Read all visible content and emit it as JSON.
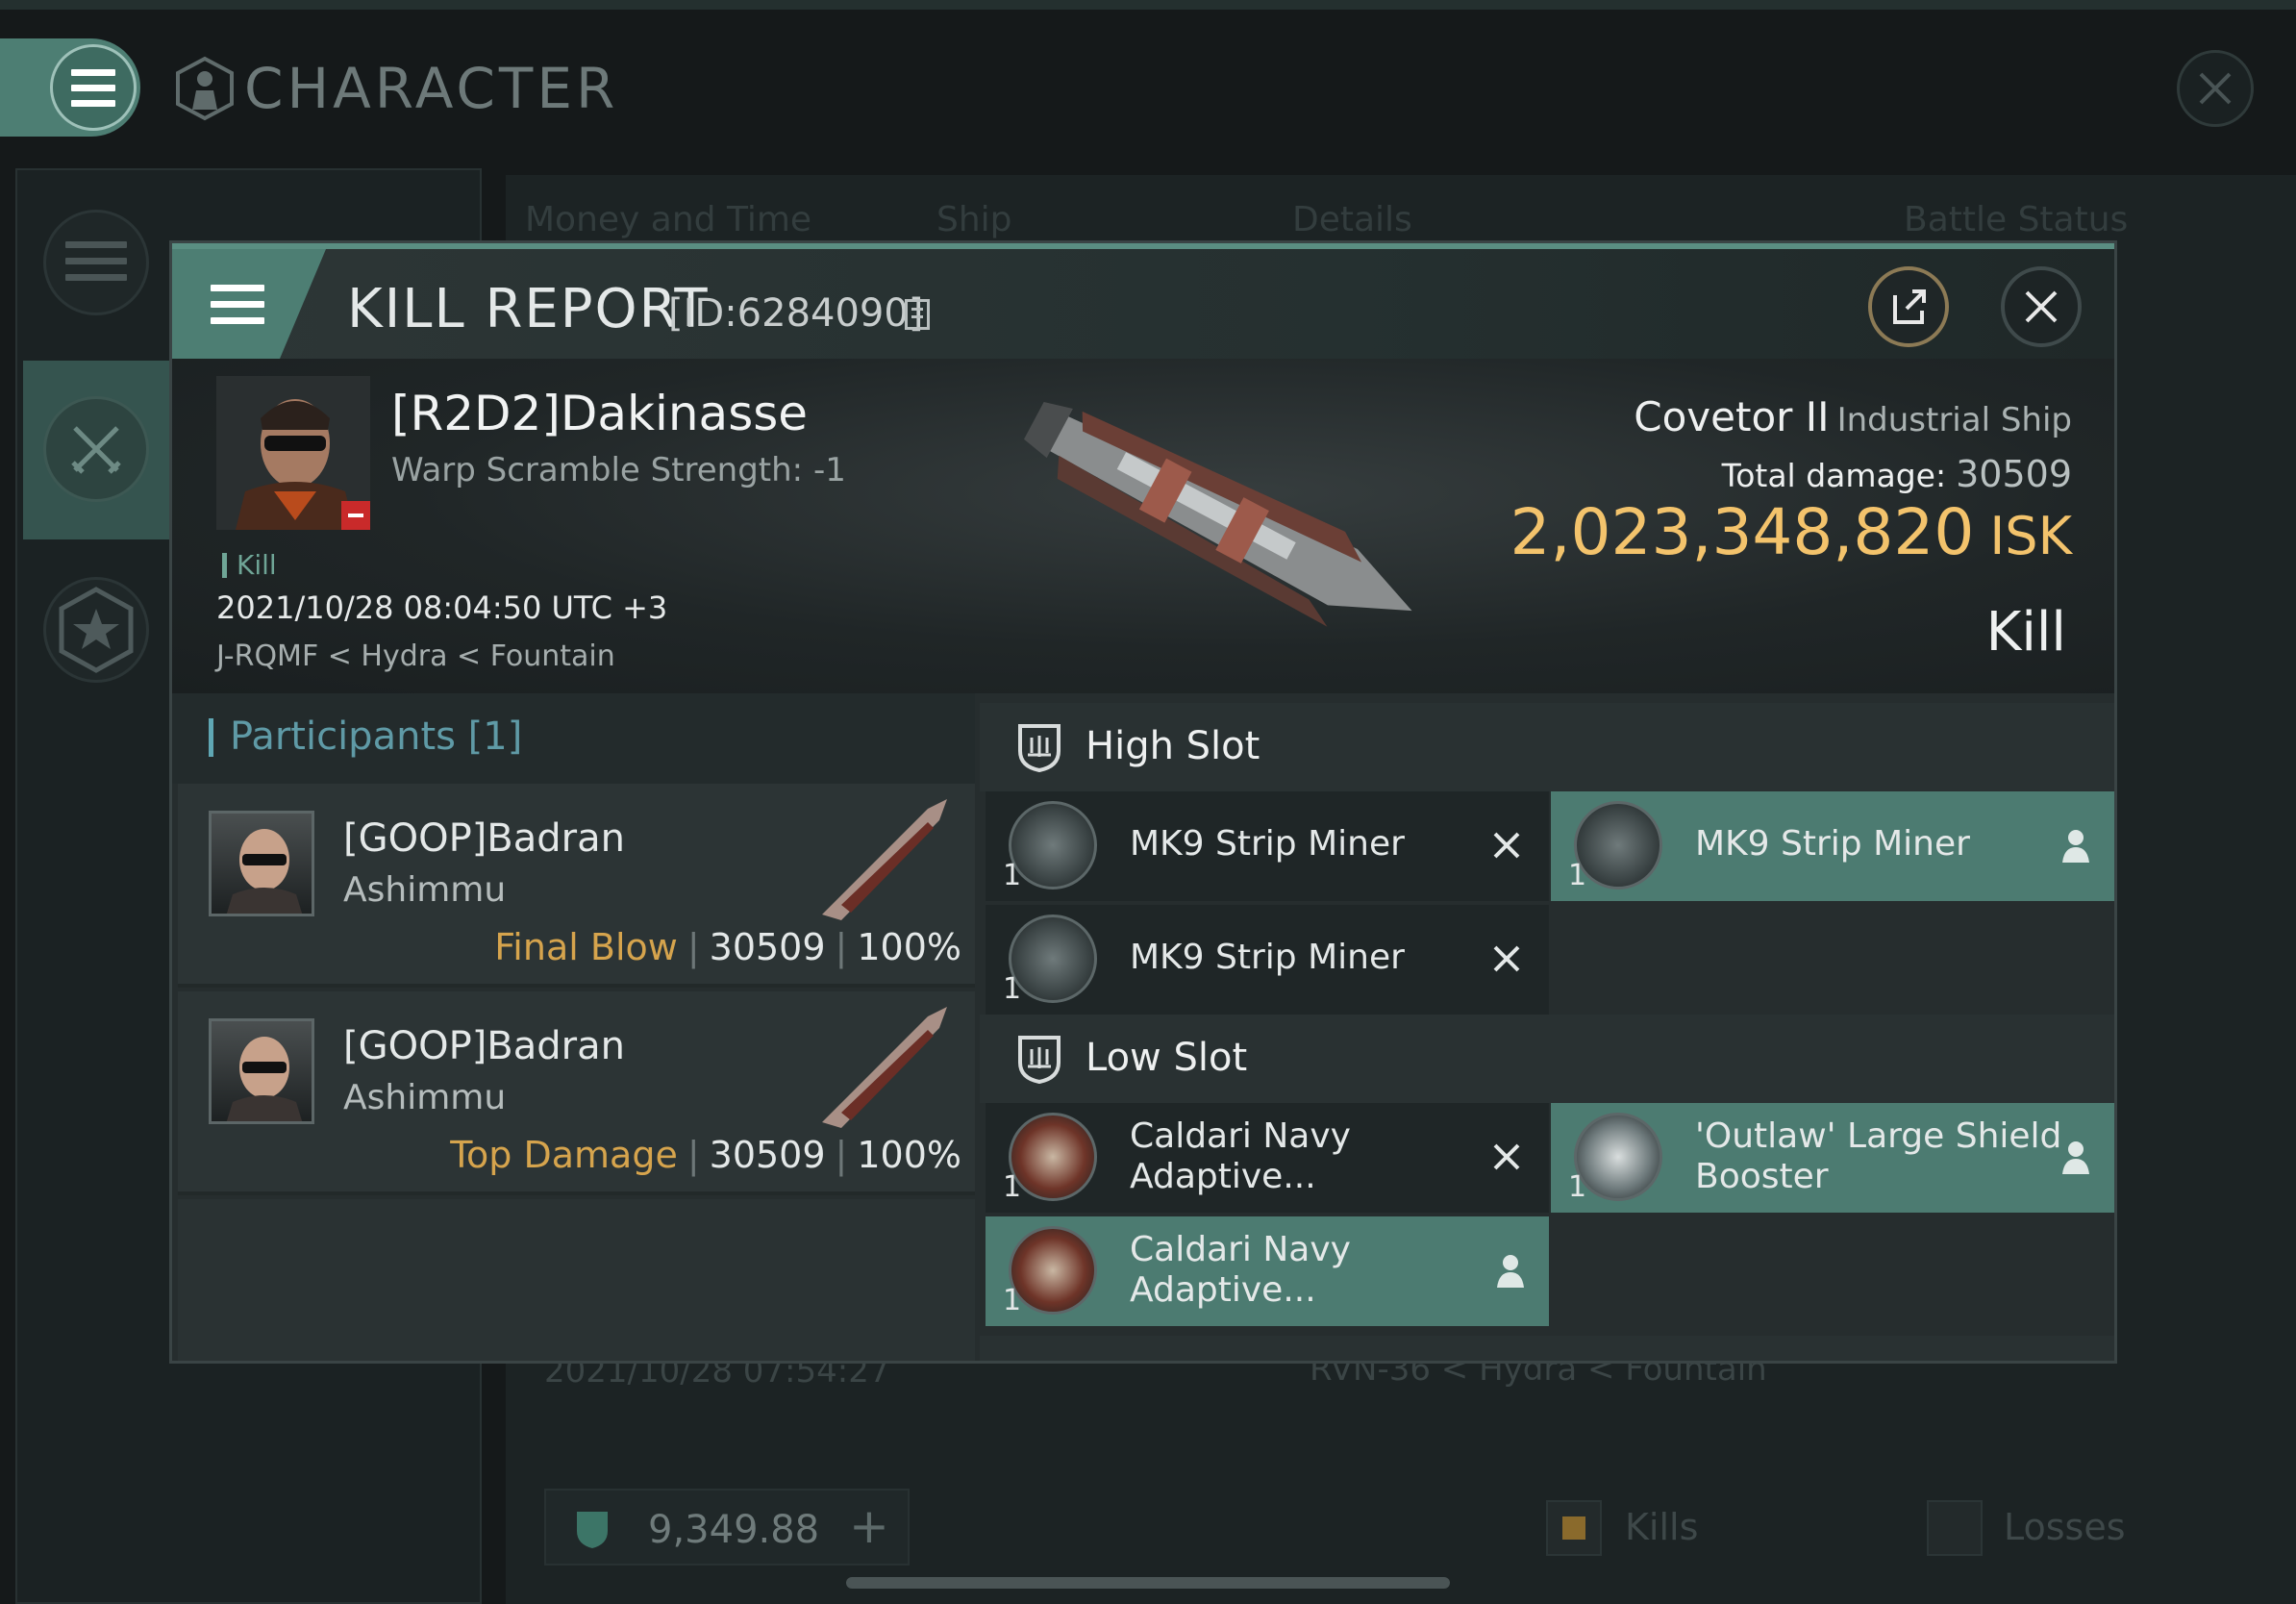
{
  "window": {
    "title": "CHARACTER"
  },
  "background": {
    "tabs": [
      "Money and Time",
      "Ship",
      "Details",
      "Battle Status"
    ],
    "row_date": "2021/10/28  07:54:27",
    "row_location": "RVN-36 < Hydra < Fountain",
    "wallet": "9,349.88",
    "legend_kills": "Kills",
    "legend_losses": "Losses"
  },
  "kill_report": {
    "title": "KILL REPORT",
    "id": "[ID:6284090]",
    "victim": {
      "name": "[R2D2]Dakinasse",
      "warp": "Warp Scramble Strength: -1",
      "tag": "Kill",
      "datetime": "2021/10/28 08:04:50 UTC +3",
      "location": "J-RQMF < Hydra < Fountain"
    },
    "ship": {
      "name": "Covetor II",
      "class": "Industrial Ship",
      "total_damage_label": "Total damage:",
      "total_damage": "30509",
      "isk_value": "2,023,348,820",
      "isk_unit": "ISK",
      "result": "Kill"
    },
    "participants": {
      "header": "Participants [1]",
      "items": [
        {
          "name": "[GOOP]Badran",
          "ship": "Ashimmu",
          "label": "Final Blow",
          "damage": "30509",
          "percent": "100%"
        },
        {
          "name": "[GOOP]Badran",
          "ship": "Ashimmu",
          "label": "Top Damage",
          "damage": "30509",
          "percent": "100%"
        }
      ]
    },
    "slots": {
      "high": {
        "label": "High Slot",
        "modules": [
          {
            "qty": "1",
            "name": "MK9 Strip Miner",
            "state": "destroyed",
            "icon": "strip-miner-icon"
          },
          {
            "qty": "1",
            "name": "MK9 Strip Miner",
            "state": "dropped",
            "icon": "strip-miner-icon"
          },
          {
            "qty": "1",
            "name": "MK9 Strip Miner",
            "state": "destroyed",
            "icon": "strip-miner-icon"
          }
        ]
      },
      "low": {
        "label": "Low Slot",
        "modules": [
          {
            "qty": "1",
            "name": "Caldari Navy Adaptive...",
            "line1": "Caldari Navy",
            "line2": "Adaptive...",
            "state": "destroyed",
            "icon": "adaptive-plating-icon"
          },
          {
            "qty": "1",
            "name": "'Outlaw' Large Shield Booster",
            "line1": "'Outlaw' Large Shield",
            "line2": "Booster",
            "state": "dropped",
            "icon": "shield-booster-icon"
          },
          {
            "qty": "1",
            "name": "Caldari Navy Adaptive...",
            "line1": "Caldari Navy",
            "line2": "Adaptive...",
            "state": "dropped",
            "icon": "adaptive-plating-icon"
          }
        ]
      }
    }
  },
  "colors": {
    "accent": "#4d7e73",
    "isk": "#f3c36c",
    "final_blow": "#d6a44d",
    "participants_header": "#5f9aa6",
    "destroyed_bg": "#1f2627",
    "dropped_bg": "#4c7b71"
  }
}
